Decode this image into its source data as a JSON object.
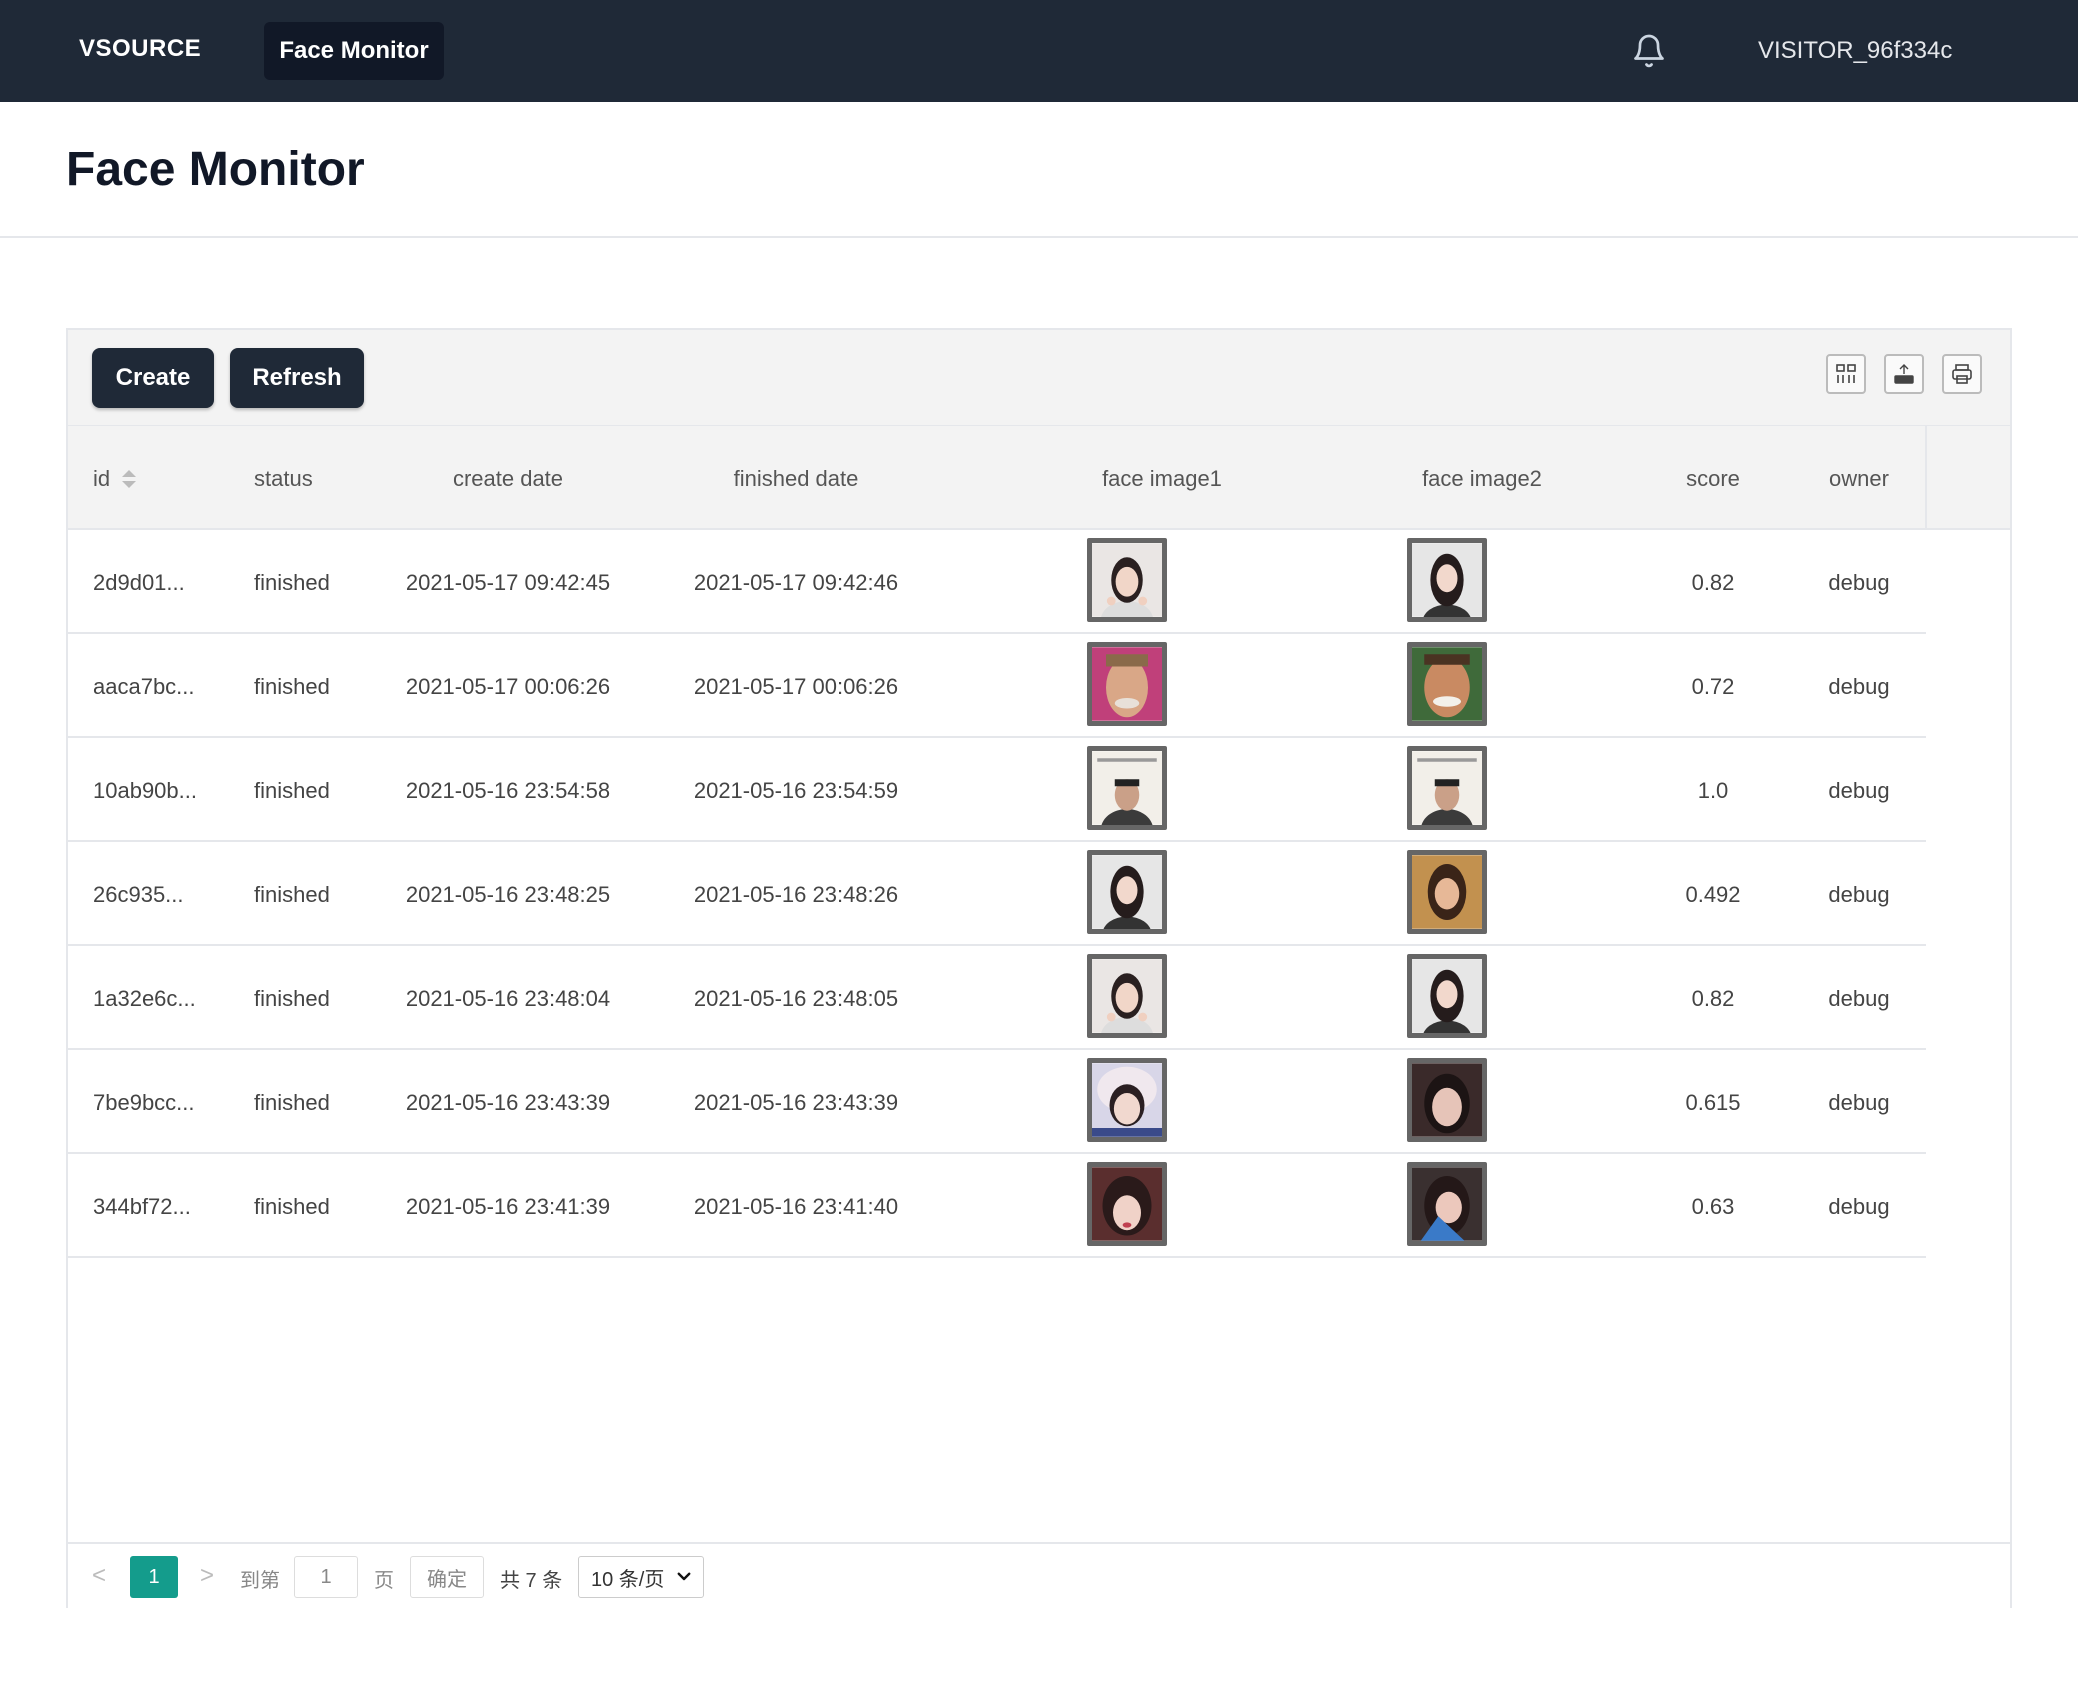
{
  "nav": {
    "brand": "VSOURCE",
    "active_tab": "Face Monitor",
    "bell_icon": "bell-icon",
    "user": "VISITOR_96f334c"
  },
  "page": {
    "title": "Face Monitor"
  },
  "toolbar": {
    "create_label": "Create",
    "refresh_label": "Refresh",
    "icons": [
      "columns-icon",
      "export-icon",
      "print-icon"
    ]
  },
  "table": {
    "columns": [
      "id",
      "status",
      "create date",
      "finished date",
      "face image1",
      "face image2",
      "score",
      "owner"
    ],
    "rows": [
      {
        "id": "2d9d01...",
        "status": "finished",
        "create_date": "2021-05-17 09:42:45",
        "finished_date": "2021-05-17 09:42:46",
        "score": "0.82",
        "owner": "debug"
      },
      {
        "id": "aaca7bc...",
        "status": "finished",
        "create_date": "2021-05-17 00:06:26",
        "finished_date": "2021-05-17 00:06:26",
        "score": "0.72",
        "owner": "debug"
      },
      {
        "id": "10ab90b...",
        "status": "finished",
        "create_date": "2021-05-16 23:54:58",
        "finished_date": "2021-05-16 23:54:59",
        "score": "1.0",
        "owner": "debug"
      },
      {
        "id": "26c935...",
        "status": "finished",
        "create_date": "2021-05-16 23:48:25",
        "finished_date": "2021-05-16 23:48:26",
        "score": "0.492",
        "owner": "debug"
      },
      {
        "id": "1a32e6c...",
        "status": "finished",
        "create_date": "2021-05-16 23:48:04",
        "finished_date": "2021-05-16 23:48:05",
        "score": "0.82",
        "owner": "debug"
      },
      {
        "id": "7be9bcc...",
        "status": "finished",
        "create_date": "2021-05-16 23:43:39",
        "finished_date": "2021-05-16 23:43:39",
        "score": "0.615",
        "owner": "debug"
      },
      {
        "id": "344bf72...",
        "status": "finished",
        "create_date": "2021-05-16 23:41:39",
        "finished_date": "2021-05-16 23:41:40",
        "score": "0.63",
        "owner": "debug"
      }
    ]
  },
  "pagination": {
    "prev": "<",
    "current_page": "1",
    "next": ">",
    "goto_label": "到第",
    "goto_value": "1",
    "page_label": "页",
    "confirm_label": "确定",
    "total_label": "共 7 条",
    "page_size": "10 条/页"
  },
  "colors": {
    "nav_bg": "#1f2937",
    "button_bg": "#1f2937",
    "pager_active": "#149c8c"
  }
}
